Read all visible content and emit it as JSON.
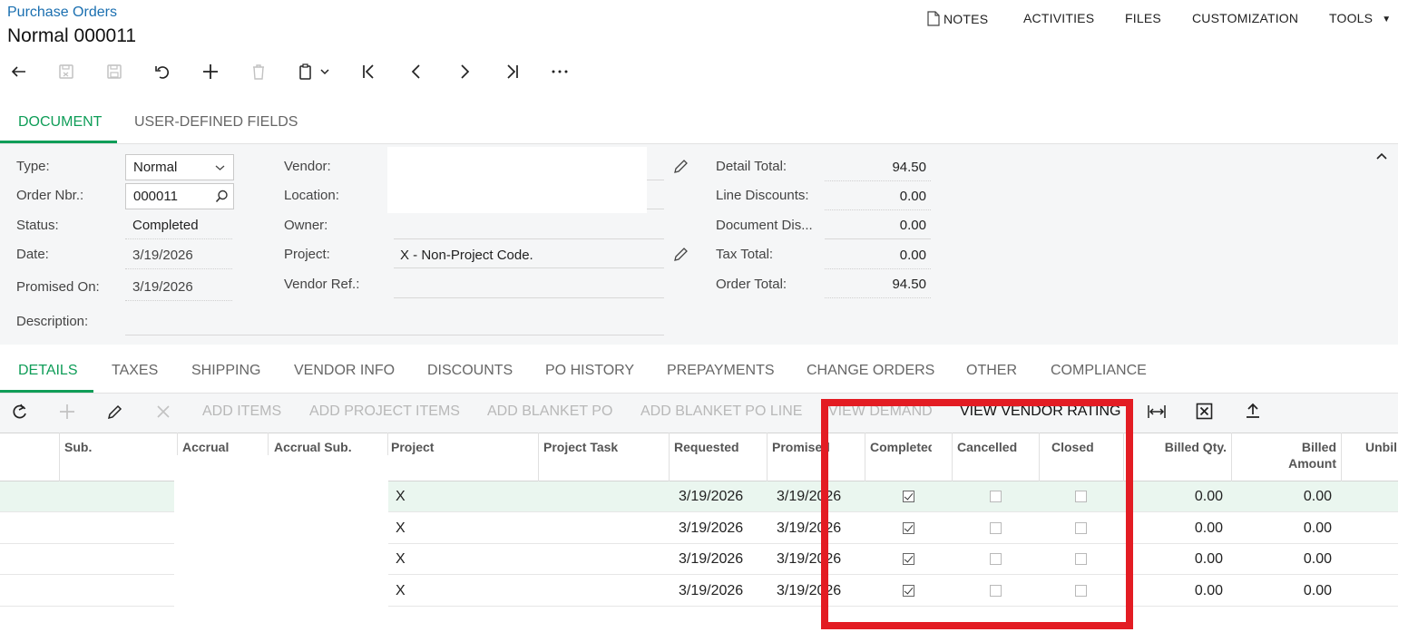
{
  "header": {
    "breadcrumb": "Purchase Orders",
    "title": "Normal 000011",
    "nav": {
      "notes": "NOTES",
      "activities": "ACTIVITIES",
      "files": "FILES",
      "customization": "CUSTOMIZATION",
      "tools": "TOOLS"
    }
  },
  "toolbar_icons": [
    "back-icon",
    "save-close-icon",
    "save-icon",
    "undo-icon",
    "add-icon",
    "delete-icon",
    "copy-paste-icon",
    "first-icon",
    "prev-icon",
    "next-icon",
    "last-icon",
    "more-icon"
  ],
  "top_tabs": {
    "document": "DOCUMENT",
    "user_defined": "USER-DEFINED FIELDS"
  },
  "form": {
    "type_label": "Type:",
    "type_value": "Normal",
    "order_label": "Order Nbr.:",
    "order_value": "000011",
    "status_label": "Status:",
    "status_value": "Completed",
    "date_label": "Date:",
    "date_value": "3/19/2026",
    "promised_label": "Promised On:",
    "promised_value": "3/19/2026",
    "description_label": "Description:",
    "vendor_label": "Vendor:",
    "location_label": "Location:",
    "owner_label": "Owner:",
    "project_label": "Project:",
    "project_value": "X - Non-Project Code.",
    "vendor_ref_label": "Vendor Ref.:",
    "detail_total_label": "Detail Total:",
    "detail_total_value": "94.50",
    "line_discounts_label": "Line Discounts:",
    "line_discounts_value": "0.00",
    "document_dis_label": "Document Dis...",
    "document_dis_value": "0.00",
    "tax_total_label": "Tax Total:",
    "tax_total_value": "0.00",
    "order_total_label": "Order Total:",
    "order_total_value": "94.50"
  },
  "detail_tabs": {
    "details": "DETAILS",
    "taxes": "TAXES",
    "shipping": "SHIPPING",
    "vendor_info": "VENDOR INFO",
    "discounts": "DISCOUNTS",
    "po_history": "PO HISTORY",
    "prepayments": "PREPAYMENTS",
    "change_orders": "CHANGE ORDERS",
    "other": "OTHER",
    "compliance": "COMPLIANCE"
  },
  "grid_toolbar": {
    "add_items": "ADD ITEMS",
    "add_project_items": "ADD PROJECT ITEMS",
    "add_blanket_po": "ADD BLANKET PO",
    "add_blanket_po_line": "ADD BLANKET PO LINE",
    "view_demand": "VIEW DEMAND",
    "view_vendor_rating": "VIEW VENDOR RATING"
  },
  "columns": {
    "sub": "Sub.",
    "accrual": "Accrual",
    "accrual_sub": "Accrual Sub.",
    "project": "Project",
    "project_task": "Project Task",
    "requested": "Requested",
    "promised": "Promised",
    "completed": "Completed",
    "cancelled": "Cancelled",
    "closed": "Closed",
    "billed_qty": "Billed Qty.",
    "billed_amount_1": "Billed",
    "billed_amount_2": "Amount",
    "unbilled": "Unbil"
  },
  "rows": [
    {
      "project": "X",
      "requested": "3/19/2026",
      "promised": "3/19/2026",
      "completed": true,
      "cancelled": false,
      "closed": false,
      "billed_qty": "0.00",
      "billed_amount": "0.00"
    },
    {
      "project": "X",
      "requested": "3/19/2026",
      "promised": "3/19/2026",
      "completed": true,
      "cancelled": false,
      "closed": false,
      "billed_qty": "0.00",
      "billed_amount": "0.00"
    },
    {
      "project": "X",
      "requested": "3/19/2026",
      "promised": "3/19/2026",
      "completed": true,
      "cancelled": false,
      "closed": false,
      "billed_qty": "0.00",
      "billed_amount": "0.00"
    },
    {
      "project": "X",
      "requested": "3/19/2026",
      "promised": "3/19/2026",
      "completed": true,
      "cancelled": false,
      "closed": false,
      "billed_qty": "0.00",
      "billed_amount": "0.00"
    }
  ],
  "colors": {
    "accent": "#0f9d58",
    "link": "#1a6fb0",
    "highlight": "#e31c23"
  }
}
